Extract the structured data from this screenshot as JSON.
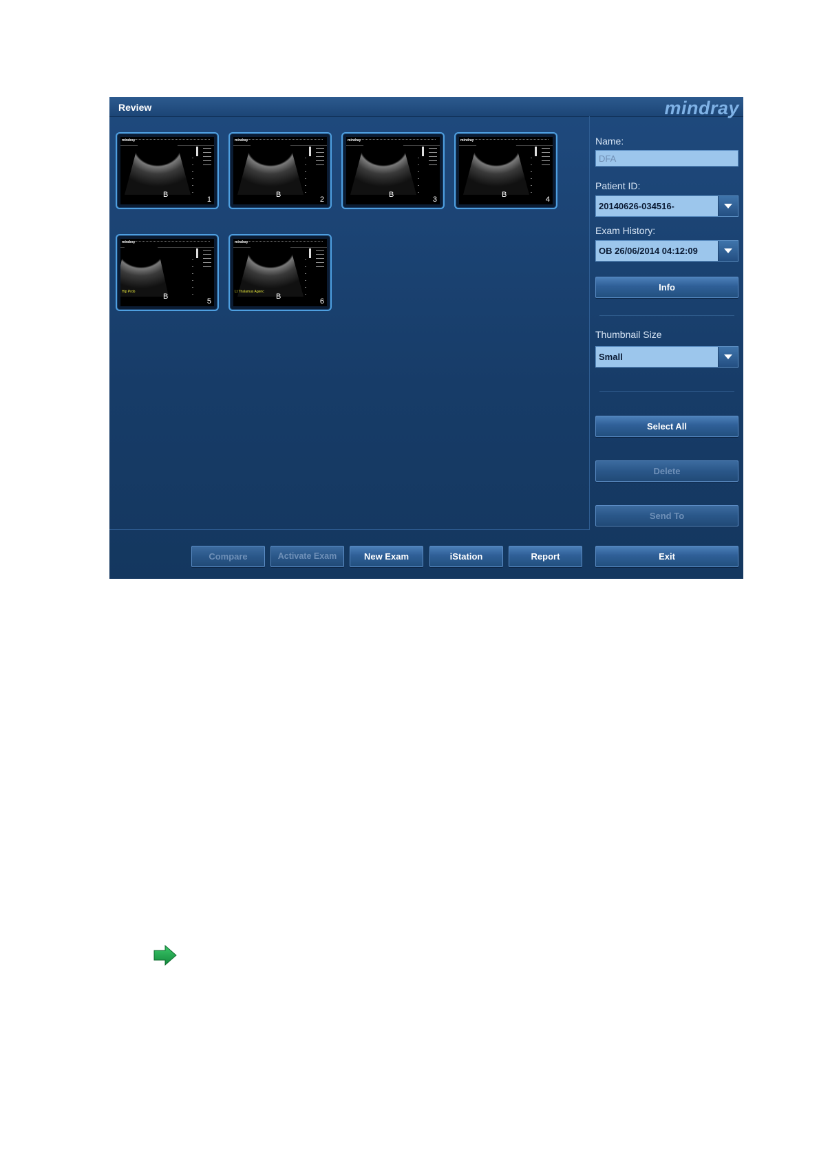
{
  "window": {
    "title": "Review",
    "brand": "mindray"
  },
  "thumbnails": [
    {
      "mode": "B",
      "index": "1",
      "note": ""
    },
    {
      "mode": "B",
      "index": "2",
      "note": ""
    },
    {
      "mode": "B",
      "index": "3",
      "note": ""
    },
    {
      "mode": "B",
      "index": "4",
      "note": ""
    },
    {
      "mode": "B",
      "index": "5",
      "note": "Hip Prob"
    },
    {
      "mode": "B",
      "index": "6",
      "note": "Lt Thalamus Agenc"
    }
  ],
  "panel": {
    "name_label": "Name:",
    "name_value": "DFA",
    "patient_id_label": "Patient ID:",
    "patient_id_value": "20140626-034516-",
    "exam_history_label": "Exam History:",
    "exam_history_value": "OB 26/06/2014 04:12:09",
    "info_button": "Info",
    "thumbnail_size_label": "Thumbnail Size",
    "thumbnail_size_value": "Small",
    "select_all_button": "Select All",
    "delete_button": "Delete",
    "send_to_button": "Send To"
  },
  "footer": {
    "compare": "Compare",
    "activate_exam": "Activate Exam",
    "new_exam": "New Exam",
    "istation": "iStation",
    "report": "Report",
    "exit": "Exit"
  },
  "colors": {
    "window_bg": "#1f4a7e",
    "thumb_border": "#4e9fe0",
    "field_bg": "#9cc6ec",
    "arrow": "#1fa24a"
  },
  "icons": [
    "dropdown-arrow-icon",
    "right-arrow-icon"
  ]
}
